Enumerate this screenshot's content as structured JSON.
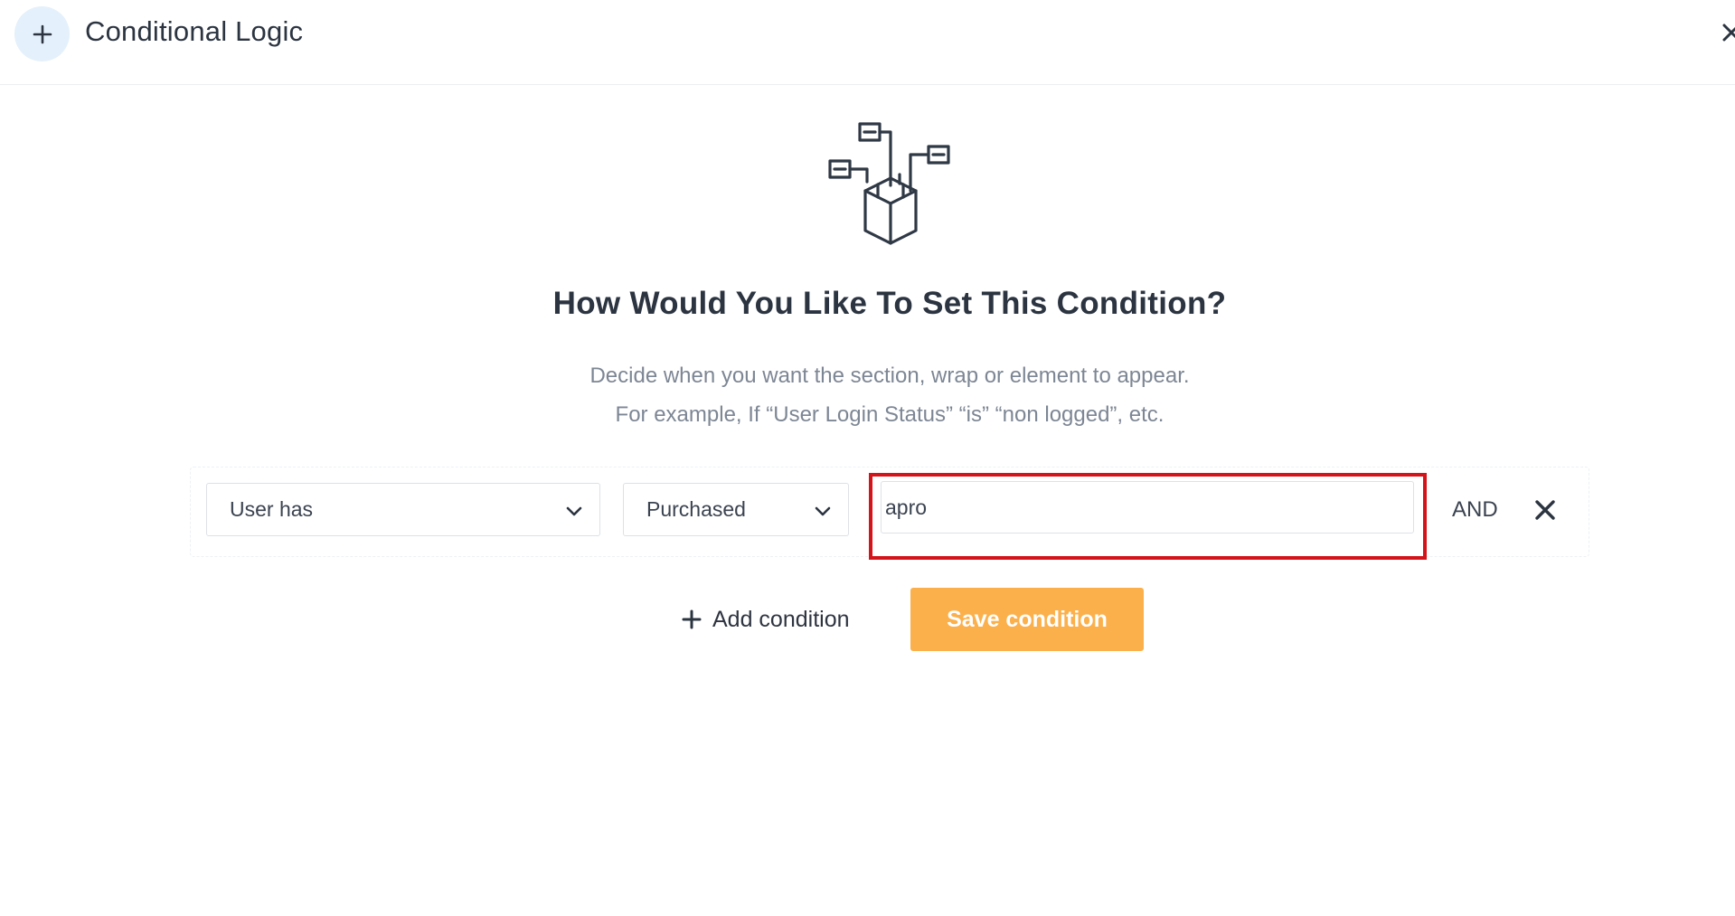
{
  "header": {
    "title": "Conditional Logic",
    "icon": "plus-icon",
    "close_icon": "close-icon"
  },
  "main": {
    "illustration": "conditional-box-icon",
    "title": "How Would You Like To Set This Condition?",
    "description_line1": "Decide when you want the section, wrap or element to appear.",
    "description_line2": "For example, If “User Login Status” “is” “non logged”, etc."
  },
  "condition_row": {
    "field_select": "User has",
    "operator_select": "Purchased",
    "value_input": "apro",
    "connector": "AND",
    "remove_icon": "close-icon"
  },
  "actions": {
    "add_condition_label": "Add condition",
    "save_condition_label": "Save condition"
  },
  "colors": {
    "accent": "#fbb04b",
    "highlight": "#d4141b",
    "header_icon_bg": "#e4f0fb",
    "text_dark": "#2b3440",
    "text_muted": "#7d8694"
  }
}
